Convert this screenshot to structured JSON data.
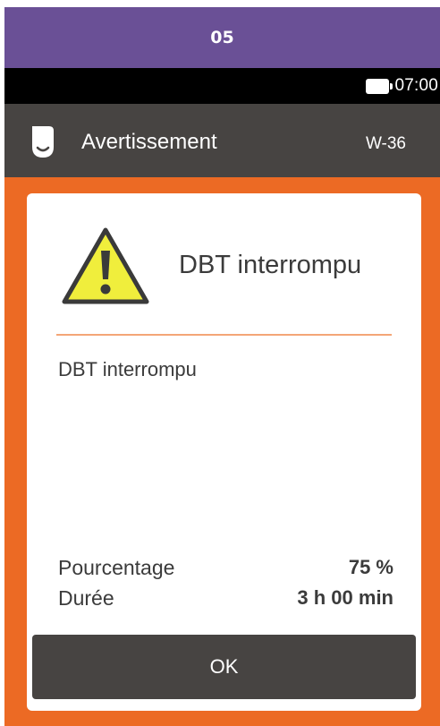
{
  "step_banner": {
    "label": "05"
  },
  "status_bar": {
    "battery_icon": "battery-icon",
    "time": "07:00"
  },
  "header": {
    "icon": "device-icon",
    "title": "Avertissement",
    "code": "W-36"
  },
  "dialog": {
    "icon": "warning-triangle-icon",
    "title": "DBT interrompu",
    "message": "DBT interrompu",
    "rows": [
      {
        "label": "Pourcentage",
        "value": "75 %"
      },
      {
        "label": "Durée",
        "value": "3 h 00 min"
      }
    ],
    "ok_label": "OK"
  },
  "colors": {
    "banner": "#6a5096",
    "header": "#474442",
    "accent": "#ec6a24",
    "warning_fill": "#f0ee3c"
  }
}
